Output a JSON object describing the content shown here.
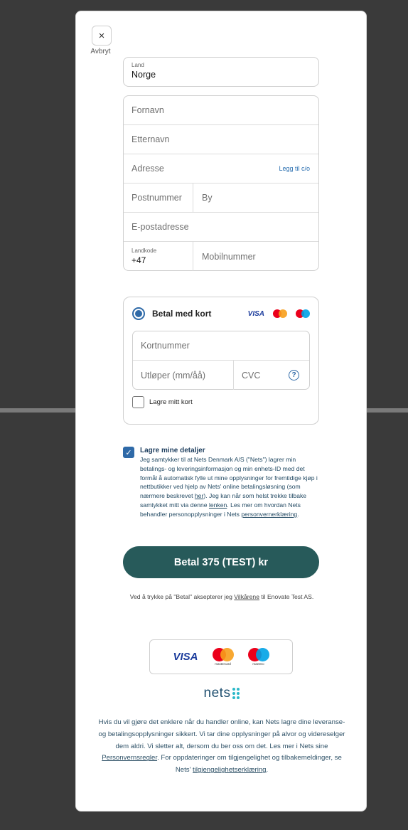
{
  "close": {
    "icon": "×",
    "label": "Avbryt"
  },
  "country": {
    "label": "Land",
    "value": "Norge"
  },
  "address": {
    "first_name_placeholder": "Fornavn",
    "last_name_placeholder": "Etternavn",
    "address_placeholder": "Adresse",
    "add_co_link": "Legg til c/o",
    "postcode_placeholder": "Postnummer",
    "city_placeholder": "By",
    "email_placeholder": "E-postadresse",
    "country_code_label": "Landkode",
    "country_code_value": "+47",
    "mobile_placeholder": "Mobilnummer"
  },
  "payment": {
    "method_label": "Betal med kort",
    "visa_text": "VISA",
    "card_number_placeholder": "Kortnummer",
    "expiry_placeholder": "Utløper (mm/åå)",
    "cvc_placeholder": "CVC",
    "help_icon": "?",
    "save_card_label": "Lagre mitt kort",
    "colors": {
      "mc_red": "#eb001b",
      "mc_orange": "#f79e1b",
      "maestro_blue": "#00a2e5"
    }
  },
  "consent": {
    "checked_icon": "✓",
    "title": "Lagre mine detaljer",
    "body_1": "Jeg samtykker til at Nets Denmark A/S (\"Nets\") lagrer min betalings- og leveringsinformasjon og min enhets-ID med det formål å automatisk fylle ut mine opplysninger for fremtidige kjøp i nettbutikker ved hjelp av Nets' online betalingsløsning (som nærmere beskrevet ",
    "link_her": "her",
    "body_2": "). Jeg kan når som helst trekke tilbake samtykket mitt via denne ",
    "link_lenken": "lenken",
    "body_3": ". Les mer om hvordan Nets behandler personopplysninger i Nets ",
    "link_privacy": "personvernerklæring",
    "body_4": "."
  },
  "pay_button": {
    "label": "Betal 375 (TEST) kr",
    "color": "#275a5a"
  },
  "terms": {
    "prefix": "Ved å trykke på \"Betal\" aksepterer jeg ",
    "link": "Vilkårene",
    "suffix": " til Enovate Test AS."
  },
  "brands": {
    "visa": "VISA",
    "mastercard": "mastercard",
    "maestro": "maestro"
  },
  "nets": {
    "logo_text": "nets"
  },
  "footer": {
    "text_1": "Hvis du vil gjøre det enklere når du handler online, kan Nets lagre dine leveranse- og betalingsopplysninger sikkert. Vi tar dine opplysninger på alvor og videreselger dem aldri. Vi sletter alt, dersom du ber oss om det. Les mer i Nets sine ",
    "link_1": "Personvernsregler",
    "text_2": ". For oppdateringer om tilgjengelighet og tilbakemeldinger, se Nets' ",
    "link_2": "tilgjengelighetserklæring",
    "text_3": "."
  }
}
